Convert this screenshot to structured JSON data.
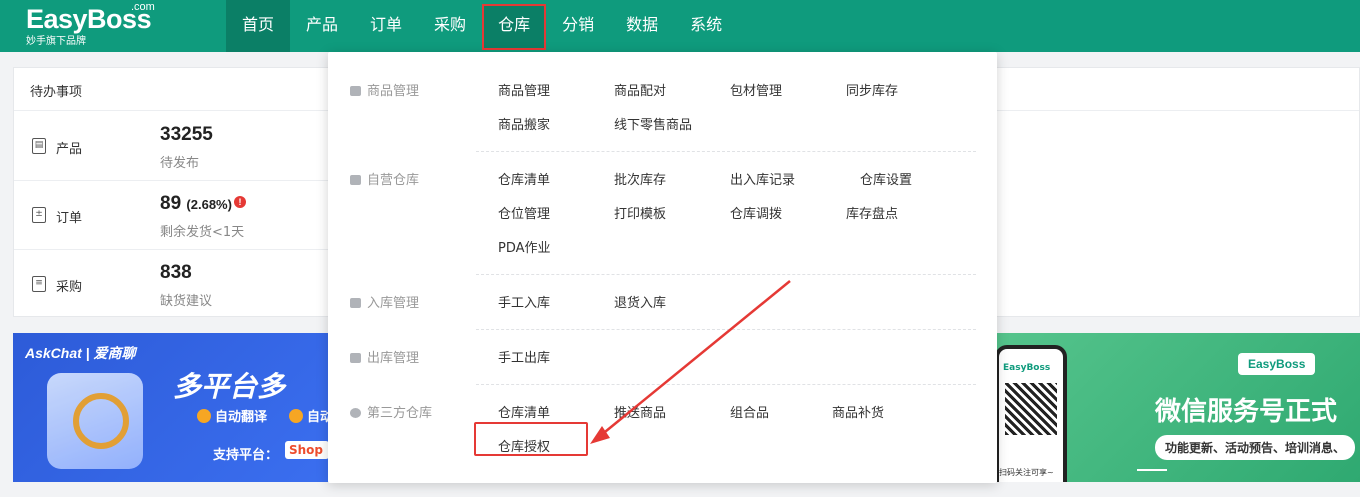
{
  "logo": {
    "brand": "EasyBoss",
    "com": ".com",
    "subtitle": "妙手旗下品牌"
  },
  "nav": [
    "首页",
    "产品",
    "订单",
    "采购",
    "仓库",
    "分销",
    "数据",
    "系统"
  ],
  "pending": {
    "title": "待办事项",
    "rows": [
      {
        "label": "产品",
        "value": "33255",
        "extra": "",
        "desc": "待发布",
        "icon": "product-icon"
      },
      {
        "label": "订单",
        "value": "89",
        "extra": "(2.68%)",
        "desc": "剩余发货<1天",
        "icon": "order-icon"
      },
      {
        "label": "采购",
        "value": "838",
        "extra": "",
        "desc": "缺货建议",
        "icon": "purchase-icon"
      }
    ]
  },
  "banner_left": {
    "brand": "AskChat | 爱商聊",
    "headline": "多平台多",
    "chip1": "自动翻译",
    "chip2": "自动",
    "platform_label": "支持平台：",
    "shop": "Shop"
  },
  "banner_right": {
    "phone_brand": "EasyBoss",
    "scan_text": "扫码关注可享~",
    "badge": "EasyBoss",
    "title": "微信服务号正式",
    "subtitle": "功能更新、活动预告、培训消息、"
  },
  "dropdown": {
    "categories": [
      {
        "name": "商品管理",
        "items": [
          "商品管理",
          "商品配对",
          "包材管理",
          "同步库存",
          "商品搬家",
          "线下零售商品"
        ]
      },
      {
        "name": "自营仓库",
        "items": [
          "仓库清单",
          "批次库存",
          "出入库记录",
          "仓库设置",
          "仓位管理",
          "打印模板",
          "仓库调拨",
          "库存盘点",
          "PDA作业"
        ]
      },
      {
        "name": "入库管理",
        "items": [
          "手工入库",
          "退货入库"
        ]
      },
      {
        "name": "出库管理",
        "items": [
          "手工出库"
        ]
      },
      {
        "name": "第三方仓库",
        "items": [
          "仓库清单",
          "推送商品",
          "组合品",
          "商品补货",
          "仓库授权"
        ]
      }
    ]
  },
  "colors": {
    "primary": "#0f9b7d",
    "highlight": "#e53935"
  }
}
